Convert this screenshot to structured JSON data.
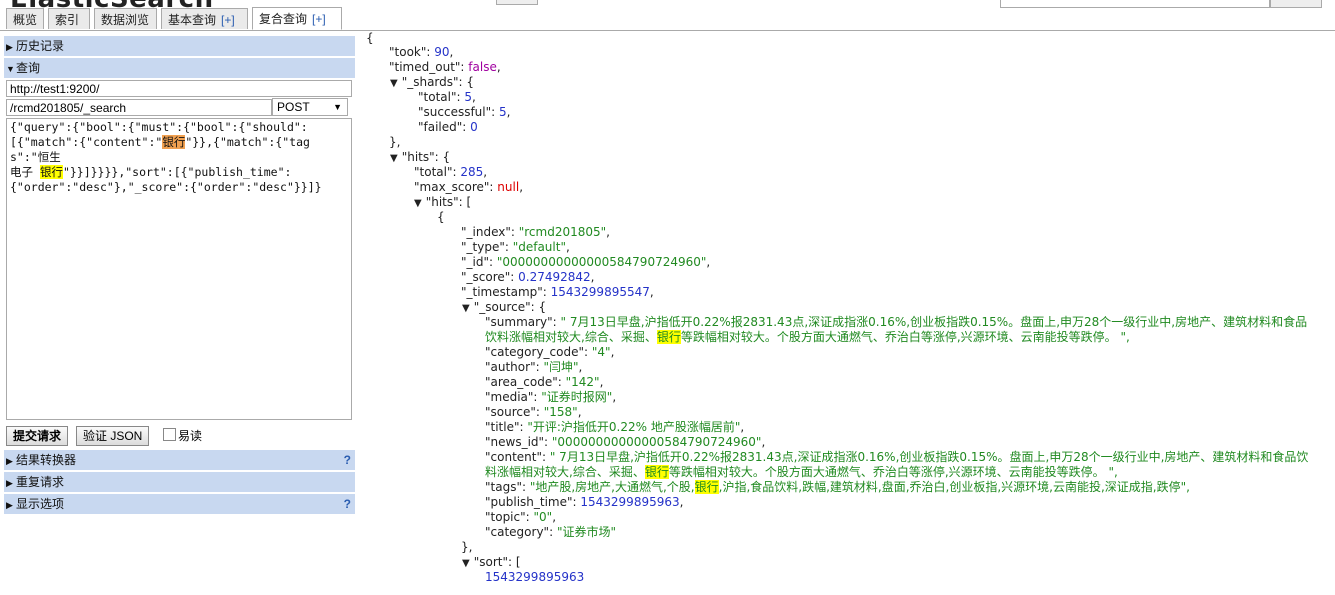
{
  "app": {
    "title": "ElasticSearch"
  },
  "tabs": [
    {
      "label": "概览"
    },
    {
      "label": "索引"
    },
    {
      "label": "数据浏览"
    },
    {
      "label": "基本查询",
      "plus": "[+]"
    },
    {
      "label": "复合查询",
      "plus": "[+]"
    }
  ],
  "sidebar": {
    "history": "历史记录",
    "query": "查询",
    "host": "http://test1:9200/",
    "path": "/rcmd201805/_search",
    "method": "POST",
    "body_parts": [
      "{\"query\":{\"bool\":{\"must\":{\"bool\":{\"should\":\n[{\"match\":{\"content\":\"",
      "银行",
      "\"}},{\"match\":{\"tags\":\"恒生\n电子 ",
      "银行",
      "\"}}]}}}},\"sort\":[{\"publish_time\":\n{\"order\":\"desc\"},\"_score\":{\"order\":\"desc\"}}]}"
    ],
    "submit": "提交请求",
    "validate": "验证 JSON",
    "easy_read": "易读",
    "transformer": "结果转换器",
    "repeat": "重复请求",
    "display": "显示选项",
    "help": "?"
  },
  "result": {
    "took": "90",
    "timed_out": "false",
    "shards": {
      "total": "5",
      "successful": "5",
      "failed": "0"
    },
    "hits_total": "285",
    "max_score": "null",
    "hit": {
      "index": "\"rcmd201805\"",
      "type": "\"default\"",
      "id": "\"00000000000000584790724960\"",
      "score": "0.27492842",
      "timestamp": "1543299895547",
      "summary_1": "\"     7月13日早盘,沪指低开0.22%报2831.43点,深证成指涨0.16%,创业板指跌0.15%。盘面上,申万28个一级行业中,房地产、建筑材料和食品",
      "summary_2a": "饮料涨幅相对较大,综合、采掘、",
      "summary_hl": "银行",
      "summary_2b": "等跌幅相对较大。个股方面大通燃气、乔治白等涨停,兴源环境、云南能投等跌停。 \",",
      "category_code": "\"4\"",
      "author": "\"闫坤\"",
      "area_code": "\"142\"",
      "media": "\"证券时报网\"",
      "source": "\"158\"",
      "title": "\"开评:沪指低开0.22% 地产股涨幅居前\"",
      "news_id": "\"00000000000000584790724960\"",
      "content_1": "\"     7月13日早盘,沪指低开0.22%报2831.43点,深证成指涨0.16%,创业板指跌0.15%。盘面上,申万28个一级行业中,房地产、建筑材料和食品饮",
      "content_2a": "料涨幅相对较大,综合、采掘、",
      "content_hl": "银行",
      "content_2b": "等跌幅相对较大。个股方面大通燃气、乔治白等涨停,兴源环境、云南能投等跌停。 \",",
      "tags_a": "\"地产股,房地产,大通燃气,个股,",
      "tags_hl": "银行",
      "tags_b": ",沪指,食品饮料,跌幅,建筑材料,盘面,乔治白,创业板指,兴源环境,云南能投,深证成指,跌停\",",
      "publish_time": "1543299895963",
      "topic": "\"0\"",
      "category": "\"证券市场\"",
      "sort_value": "1543299895963"
    }
  }
}
